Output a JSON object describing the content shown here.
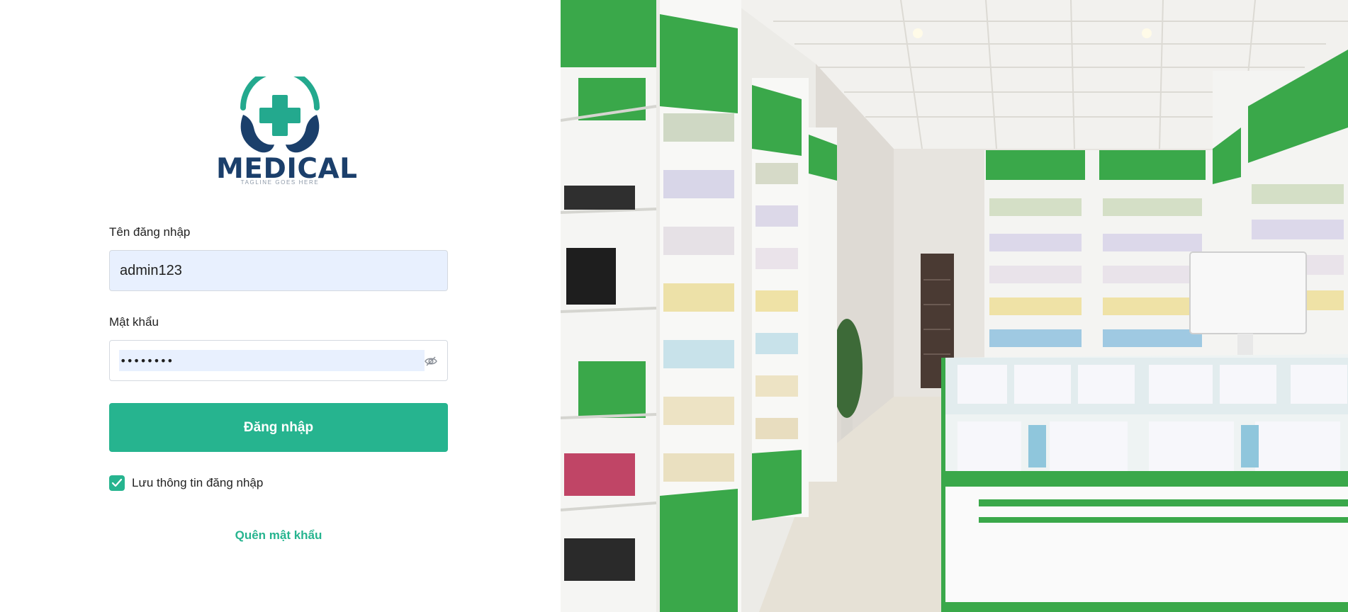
{
  "logo": {
    "name": "MEDICAL",
    "tagline": "TAGLINE GOES HERE",
    "icon": "hands-cross-logo"
  },
  "form": {
    "username_label": "Tên đăng nhập",
    "username_value": "admin123",
    "password_label": "Mật khẩu",
    "password_value": "••••••••",
    "password_toggle_icon": "eye-slash-icon",
    "submit_label": "Đăng nhập",
    "remember_label": "Lưu thông tin đăng nhập",
    "remember_checked": true,
    "forgot_label": "Quên mật khẩu"
  },
  "hero_image": {
    "subject": "pharmacy-store-interior"
  },
  "colors": {
    "accent": "#26b48f",
    "logo_navy": "#1b3f6b",
    "input_autofill_bg": "#e8f0fe",
    "shelf_green": "#3aa84a"
  }
}
